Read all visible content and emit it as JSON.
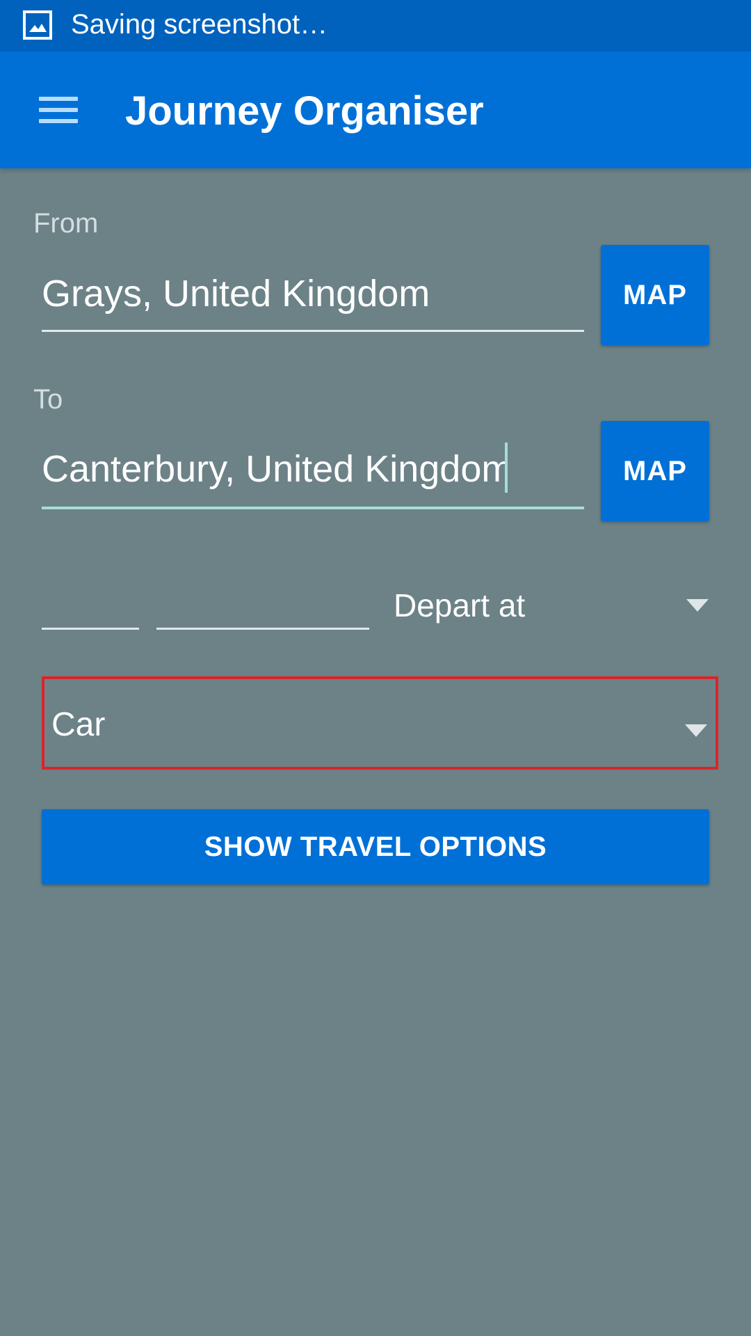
{
  "status_bar": {
    "icon": "screenshot-image-icon",
    "text": "Saving screenshot…"
  },
  "app_bar": {
    "menu_icon": "hamburger-menu-icon",
    "title": "Journey Organiser"
  },
  "form": {
    "from": {
      "label": "From",
      "value": "Grays, United Kingdom",
      "map_label": "MAP"
    },
    "to": {
      "label": "To",
      "value": "Canterbury, United Kingdom",
      "map_label": "MAP"
    },
    "depart": {
      "date_value": "",
      "time_value": "",
      "mode_selected": "Depart at"
    },
    "transport": {
      "selected": "Car"
    },
    "submit_label": "SHOW TRAVEL OPTIONS"
  },
  "colors": {
    "status_bar": "#0062bd",
    "app_bar": "#0070d6",
    "background": "#6c8287",
    "button": "#0070d6",
    "highlight_border": "#d9242b",
    "focus_underline": "#a7dcd6"
  }
}
